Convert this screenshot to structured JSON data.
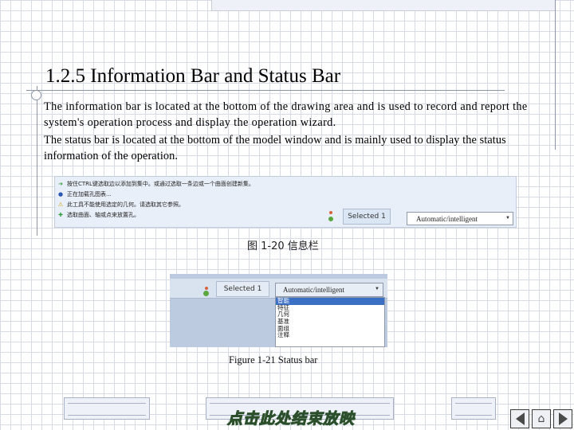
{
  "title": "1.2.5  Information Bar and Status Bar",
  "paragraphs": [
    "The information bar is located at the bottom of the drawing area and is used to record and report the system's operation process and display the operation wizard.",
    "The status bar is located at the bottom of the model window and is mainly used to display the status information of the operation."
  ],
  "figure_20": {
    "messages": [
      {
        "icon": "arrow-icon",
        "text": "按住CTRL键选取边以添加到集中。或通过选取一条边或一个曲面创建新集。"
      },
      {
        "icon": "info-dot-icon",
        "text": "正在加载孔图表..."
      },
      {
        "icon": "warning-icon",
        "text": "此工具不能使用选定的几何。请选取其它参照。"
      },
      {
        "icon": "add-icon",
        "text": "选取曲面、轴或点来放置孔。"
      }
    ],
    "selected": "Selected 1",
    "filter": "Automatic/intelligent",
    "caption": "图 1-20   信息栏"
  },
  "figure_21": {
    "selected": "Selected 1",
    "filter": "Automatic/intelligent",
    "options": [
      "智能",
      "特征",
      "几何",
      "基准",
      "面组",
      "注释"
    ],
    "selected_option_index": 0,
    "caption": "Figure 1-21 Status bar"
  },
  "end_show": "点击此处结束放映",
  "colors": {
    "grid": "#d6dbe6",
    "accent_line": "#8c96a8",
    "selected_option": "#3b6fc4",
    "panel": "#e9eff8"
  }
}
